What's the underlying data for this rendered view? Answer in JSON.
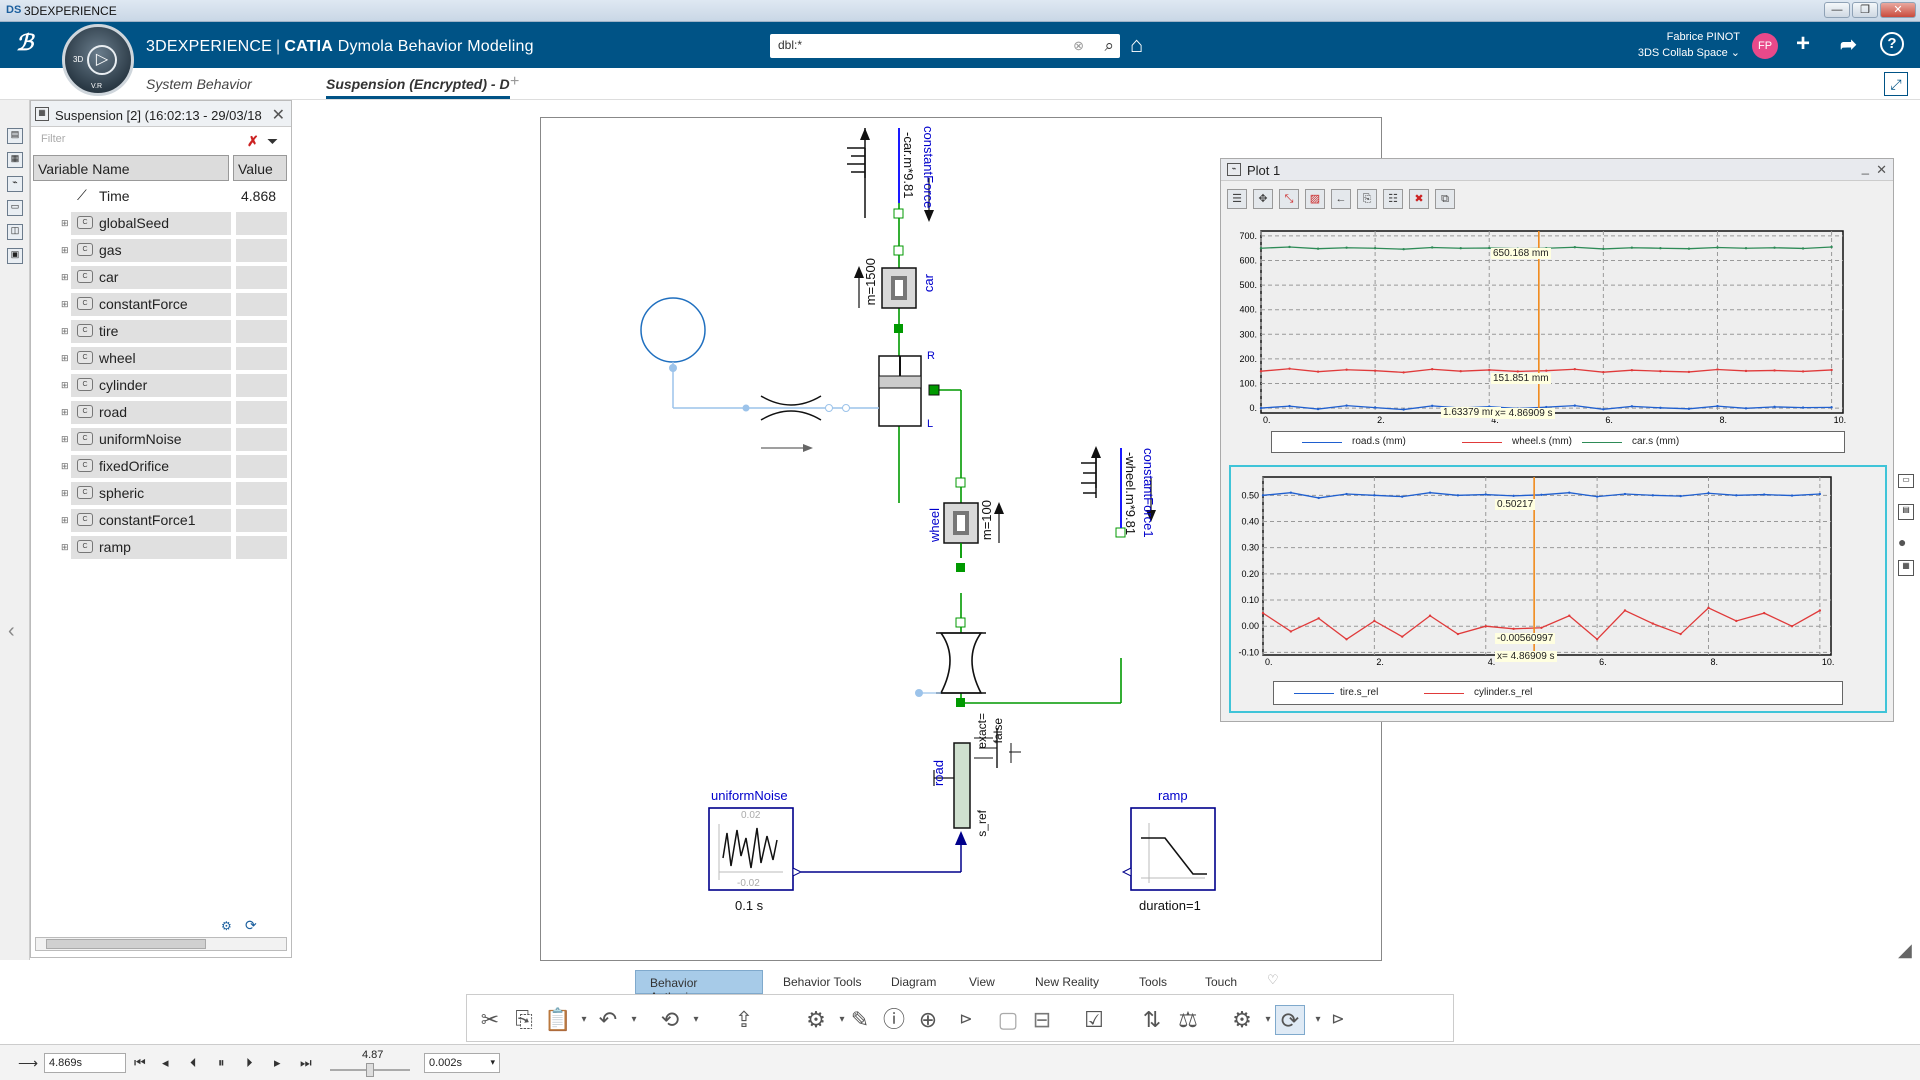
{
  "window": {
    "title": "3DEXPERIENCE",
    "minimize": "—",
    "restore": "❐",
    "close": "✕"
  },
  "app": {
    "brand_prefix": "3DEXPERIENCE",
    "brand_app": "CATIA",
    "brand_module": "Dymola Behavior Modeling",
    "compass_label": "V.R",
    "compass_3d": "3D"
  },
  "search": {
    "value": "dbl:*"
  },
  "user": {
    "name": "Fabrice PINOT",
    "space": "3DS Collab Space",
    "initials": "FP"
  },
  "tabs": [
    {
      "label": "System Behavior"
    },
    {
      "label": "Suspension (Encrypted) - D"
    },
    {
      "label": "+"
    }
  ],
  "var_panel": {
    "title": "Suspension [2] (16:02:13 - 29/03/18",
    "filter_placeholder": "Filter",
    "col_name": "Variable Name",
    "col_value": "Value",
    "rows": [
      {
        "name": "Time",
        "value": "4.868"
      },
      {
        "name": "globalSeed",
        "value": ""
      },
      {
        "name": "gas",
        "value": ""
      },
      {
        "name": "car",
        "value": ""
      },
      {
        "name": "constantForce",
        "value": ""
      },
      {
        "name": "tire",
        "value": ""
      },
      {
        "name": "wheel",
        "value": ""
      },
      {
        "name": "cylinder",
        "value": ""
      },
      {
        "name": "road",
        "value": ""
      },
      {
        "name": "uniformNoise",
        "value": ""
      },
      {
        "name": "fixedOrifice",
        "value": ""
      },
      {
        "name": "spheric",
        "value": ""
      },
      {
        "name": "constantForce1",
        "value": ""
      },
      {
        "name": "ramp",
        "value": ""
      }
    ]
  },
  "diagram": {
    "constantForce": "constantForce",
    "constantForce_expr": "-car.m*9.81",
    "car": "car",
    "car_m": "m=1500",
    "R": "R",
    "L": "L",
    "wheel": "wheel",
    "wheel_m": "m=100",
    "constantForce1": "constantForce1",
    "constantForce1_expr": "-wheel.m*9.81",
    "road": "road",
    "exact": "exact=",
    "false": "false",
    "s_ref": "s_ref",
    "uniformNoise": "uniformNoise",
    "noise_hi": "0.02",
    "noise_lo": "-0.02",
    "noise_period": "0.1 s",
    "ramp": "ramp",
    "ramp_duration": "duration=1"
  },
  "plot": {
    "title": "Plot 1",
    "min": "_",
    "close": "✕",
    "top_readouts": {
      "car": "650.168 mm",
      "wheel": "151.851 mm",
      "road": "1.63379 mm",
      "x": "x= 4.86909 s"
    },
    "bottom_readouts": {
      "tire": "0.50217",
      "cyl": "-0.00560997",
      "x": "x= 4.86909 s"
    }
  },
  "chart_data": [
    {
      "type": "line",
      "xlim": [
        0,
        10.2
      ],
      "ylim": [
        -20,
        720
      ],
      "xticks": [
        "0.",
        "2.",
        "4.",
        "6.",
        "8.",
        "10."
      ],
      "xtick_values": [
        0,
        2,
        4,
        6,
        8,
        10
      ],
      "yticks": [
        "700.",
        "600.",
        "500.",
        "400.",
        "300.",
        "200.",
        "100.",
        "0."
      ],
      "ytick_values": [
        700,
        600,
        500,
        400,
        300,
        200,
        100,
        0
      ],
      "grid": true,
      "legend": "bottom",
      "cursor_x": 4.86909,
      "series": [
        {
          "name": "road.s (mm)",
          "color": "#1f5fcf",
          "x": [
            0,
            0.5,
            1,
            1.5,
            2,
            2.5,
            3,
            3.5,
            4,
            4.5,
            5,
            5.5,
            6,
            6.5,
            7,
            7.5,
            8,
            8.5,
            9,
            9.5,
            10
          ],
          "y": [
            0,
            8,
            -4,
            10,
            2,
            -6,
            9,
            0,
            6,
            -2,
            4,
            10,
            -5,
            7,
            1,
            -3,
            8,
            -1,
            5,
            2,
            3
          ]
        },
        {
          "name": "wheel.s (mm)",
          "color": "#e03a3a",
          "x": [
            0,
            0.5,
            1,
            1.5,
            2,
            2.5,
            3,
            3.5,
            4,
            4.5,
            5,
            5.5,
            6,
            6.5,
            7,
            7.5,
            8,
            8.5,
            9,
            9.5,
            10
          ],
          "y": [
            150,
            160,
            148,
            156,
            152,
            145,
            158,
            150,
            155,
            149,
            152,
            158,
            146,
            154,
            150,
            147,
            157,
            151,
            153,
            149,
            155
          ]
        },
        {
          "name": "car.s (mm)",
          "color": "#2e8b57",
          "x": [
            0,
            0.5,
            1,
            1.5,
            2,
            2.5,
            3,
            3.5,
            4,
            4.5,
            5,
            5.5,
            6,
            6.5,
            7,
            7.5,
            8,
            8.5,
            9,
            9.5,
            10
          ],
          "y": [
            650,
            655,
            648,
            652,
            650,
            646,
            653,
            650,
            651,
            648,
            650,
            654,
            647,
            652,
            650,
            648,
            653,
            650,
            652,
            649,
            655
          ]
        }
      ]
    },
    {
      "type": "line",
      "xlim": [
        0,
        10.2
      ],
      "ylim": [
        -0.11,
        0.57
      ],
      "xticks": [
        "0.",
        "2.",
        "4.",
        "6.",
        "8.",
        "10."
      ],
      "xtick_values": [
        0,
        2,
        4,
        6,
        8,
        10
      ],
      "yticks": [
        "0.50",
        "0.40",
        "0.30",
        "0.20",
        "0.10",
        "0.00",
        "-0.10"
      ],
      "ytick_values": [
        0.5,
        0.4,
        0.3,
        0.2,
        0.1,
        0.0,
        -0.1
      ],
      "grid": true,
      "legend": "bottom",
      "cursor_x": 4.86909,
      "series": [
        {
          "name": "tire.s_rel",
          "color": "#1f5fcf",
          "x": [
            0,
            0.5,
            1,
            1.5,
            2,
            2.5,
            3,
            3.5,
            4,
            4.5,
            5,
            5.5,
            6,
            6.5,
            7,
            7.5,
            8,
            8.5,
            9,
            9.5,
            10
          ],
          "y": [
            0.5,
            0.51,
            0.49,
            0.505,
            0.5,
            0.495,
            0.51,
            0.5,
            0.503,
            0.498,
            0.502,
            0.51,
            0.495,
            0.505,
            0.5,
            0.497,
            0.508,
            0.5,
            0.503,
            0.499,
            0.505
          ]
        },
        {
          "name": "cylinder.s_rel",
          "color": "#e03a3a",
          "x": [
            0,
            0.5,
            1,
            1.5,
            2,
            2.5,
            3,
            3.5,
            4,
            4.5,
            5,
            5.5,
            6,
            6.5,
            7,
            7.5,
            8,
            8.5,
            9,
            9.5,
            10
          ],
          "y": [
            0.05,
            -0.02,
            0.03,
            -0.05,
            0.02,
            -0.04,
            0.04,
            -0.03,
            0.0,
            -0.01,
            -0.006,
            0.04,
            -0.05,
            0.06,
            0.01,
            -0.03,
            0.07,
            0.02,
            0.05,
            0.0,
            0.06
          ]
        }
      ]
    }
  ],
  "bottom_tabs": [
    "Behavior Authoring",
    "Behavior Tools",
    "Diagram",
    "View",
    "New Reality",
    "Tools",
    "Touch"
  ],
  "status": {
    "time": "4.869s",
    "slider_value": "4.87",
    "step": "0.002s"
  }
}
